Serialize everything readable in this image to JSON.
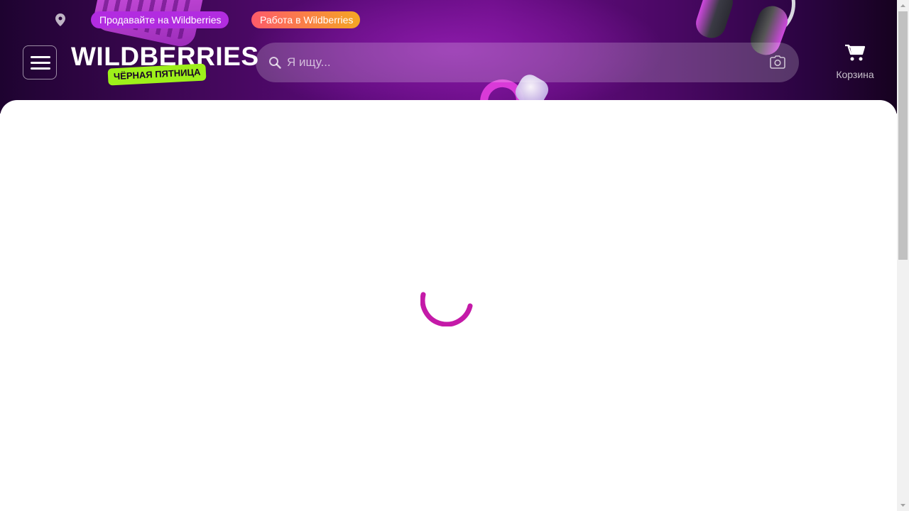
{
  "top_bar": {
    "location_icon": "location-pin-icon",
    "sell_link": "Продавайте на Wildberries",
    "job_link": "Работа в Wildberries"
  },
  "header": {
    "menu_icon": "hamburger-menu-icon",
    "logo_text": "WILDBERRIES",
    "logo_badge": "ЧЁРНАЯ ПЯТНИЦА",
    "search_placeholder": "Я ищу...",
    "search_value": "",
    "search_icon": "search-icon",
    "camera_icon": "camera-icon",
    "cart_icon": "cart-icon",
    "cart_label": "Корзина"
  },
  "main": {
    "loading_icon": "loading-spinner-icon"
  },
  "colors": {
    "header_gradient_start": "#1e0330",
    "header_gradient_mid": "#6a0c86",
    "sell_pill": "#b22ce0",
    "job_pill_start": "#ff5a6a",
    "job_pill_end": "#f5a623",
    "badge": "#9ef01a",
    "spinner": "#c41aa8"
  }
}
